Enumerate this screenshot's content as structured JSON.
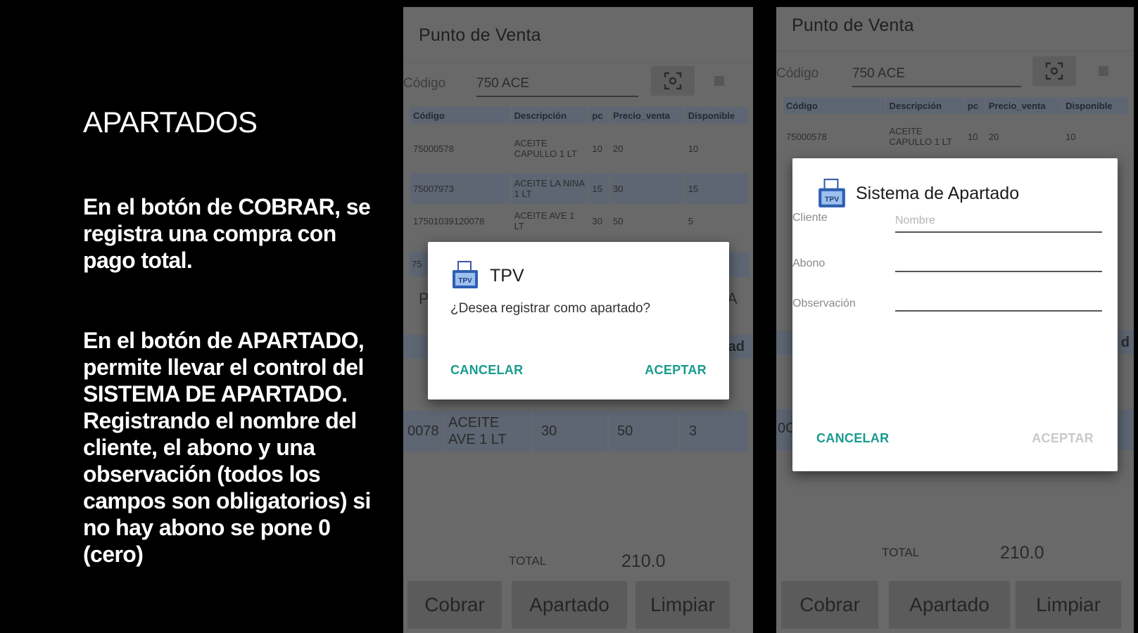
{
  "slide": {
    "heading": "APARTADOS",
    "paragraph_1": "En el botón de COBRAR, se registra una compra con pago total.",
    "paragraph_2": "En el botón de APARTADO, permite llevar el control del SISTEMA DE APARTADO. Registrando el nombre del cliente, el abono y una observación (todos los campos son obligatorios) si no hay abono se pone 0 (cero)"
  },
  "colors": {
    "accent": "#189b8e",
    "dim_overlay": "#696969",
    "row_alt": "#5d6672"
  },
  "phone1": {
    "app_title": "Punto de Venta",
    "code_label": "Código",
    "code_value": "750 ACE",
    "scan_icon": "barcode-scan-icon",
    "columns": [
      "Código",
      "Descripción",
      "pc",
      "Precio_venta",
      "Disponible"
    ],
    "rows": [
      [
        "75000578",
        "ACEITE CAPULLO 1 LT",
        "10",
        "20",
        "10"
      ],
      [
        "75007973",
        "ACEITE LA NINA 1 LT",
        "15",
        "30",
        "15"
      ],
      [
        "17501039120078",
        "ACEITE AVE 1 LT",
        "30",
        "50",
        "5"
      ]
    ],
    "partial_row_cell": "75",
    "hidden_row_hint": "P",
    "hidden_row_hint_right": "A",
    "hidden_header_tail": "ad",
    "cart_row": [
      "0078",
      "ACEITE AVE 1 LT",
      "30",
      "50",
      "3"
    ],
    "total_label": "TOTAL",
    "total_value": "210.0",
    "buttons": [
      "Cobrar",
      "Apartado",
      "Limpiar"
    ],
    "dialog": {
      "icon": "tpv-app-icon",
      "title": "TPV",
      "message": "¿Desea registrar como apartado?",
      "cancel": "CANCELAR",
      "accept": "ACEPTAR"
    }
  },
  "phone2": {
    "app_title": "Punto de Venta",
    "code_label": "Código",
    "code_value": "750 ACE",
    "columns": [
      "Código",
      "Descripción",
      "pc",
      "Precio_venta",
      "Disponible"
    ],
    "rows": [
      [
        "75000578",
        "ACEITE CAPULLO 1 LT",
        "10",
        "20",
        "10"
      ]
    ],
    "hidden_header_tail": "d",
    "cart_row_code_partial": "0C",
    "total_label": "TOTAL",
    "total_value": "210.0",
    "buttons": [
      "Cobrar",
      "Apartado",
      "Limpiar"
    ],
    "dialog": {
      "icon": "tpv-app-icon",
      "title": "Sistema de Apartado",
      "client_label": "Cliente",
      "client_placeholder": "Nombre",
      "abono_label": "Abono",
      "observacion_label": "Observación",
      "cancel": "CANCELAR",
      "accept": "ACEPTAR"
    }
  }
}
